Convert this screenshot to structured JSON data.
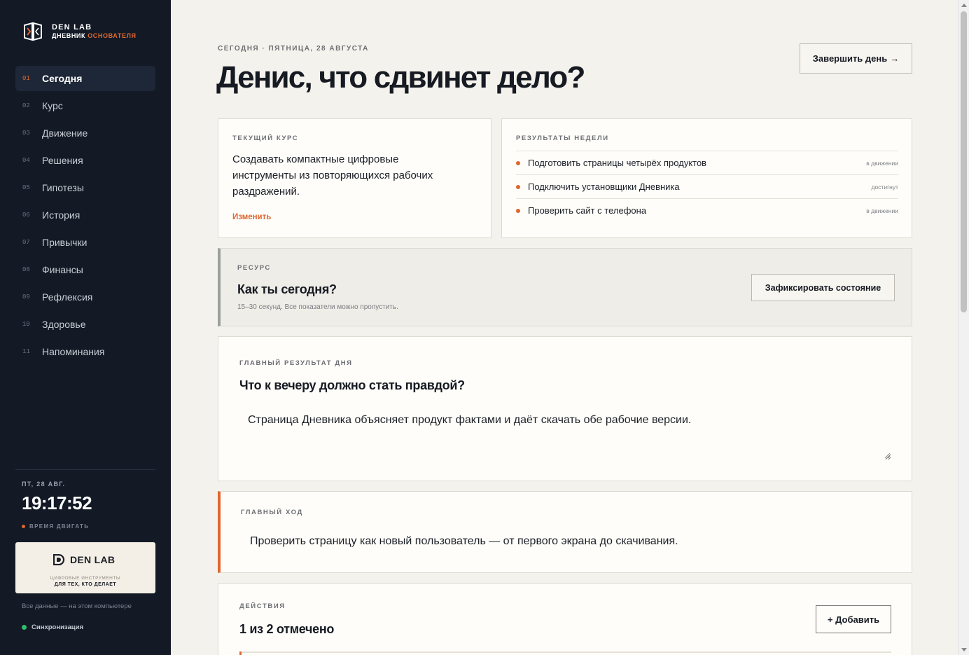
{
  "brand": {
    "name": "DEN LAB",
    "sub_prefix": "ДНЕВНИК",
    "sub_accent": "ОСНОВАТЕЛЯ"
  },
  "nav": [
    {
      "num": "01",
      "label": "Сегодня"
    },
    {
      "num": "02",
      "label": "Курс"
    },
    {
      "num": "03",
      "label": "Движение"
    },
    {
      "num": "04",
      "label": "Решения"
    },
    {
      "num": "05",
      "label": "Гипотезы"
    },
    {
      "num": "06",
      "label": "История"
    },
    {
      "num": "07",
      "label": "Привычки"
    },
    {
      "num": "08",
      "label": "Финансы"
    },
    {
      "num": "09",
      "label": "Рефлексия"
    },
    {
      "num": "10",
      "label": "Здоровье"
    },
    {
      "num": "11",
      "label": "Напоминания"
    }
  ],
  "sidebar": {
    "date": "ПТ, 28 АВГ.",
    "clock": "19:17:52",
    "motto": "ВРЕМЯ ДВИГАТЬ",
    "promo": {
      "name": "DEN LAB",
      "line1": "ЦИФРОВЫЕ ИНСТРУМЕНТЫ",
      "line2": "ДЛЯ ТЕХ, КТО ДЕЛАЕТ"
    },
    "local_note": "Все данные — на этом компьютере",
    "sync_label": "Синхронизация"
  },
  "header": {
    "eyebrow": "СЕГОДНЯ · ПЯТНИЦА, 28 АВГУСТА",
    "title": "Денис, что сдвинет дело?",
    "finish_label": "Завершить день",
    "finish_arrow": "→"
  },
  "course": {
    "label": "ТЕКУЩИЙ КУРС",
    "text": "Создавать компактные цифровые инструменты из повторяющихся рабочих раздражений.",
    "edit_label": "Изменить"
  },
  "week_results": {
    "label": "РЕЗУЛЬТАТЫ НЕДЕЛИ",
    "items": [
      {
        "text": "Подготовить страницы четырёх продуктов",
        "status": "в движении"
      },
      {
        "text": "Подключить установщики Дневника",
        "status": "достигнут"
      },
      {
        "text": "Проверить сайт с телефона",
        "status": "в движении"
      }
    ]
  },
  "resource": {
    "label": "РЕСУРС",
    "title": "Как ты сегодня?",
    "hint": "15–30 секунд. Все показатели можно пропустить.",
    "button_label": "Зафиксировать состояние"
  },
  "main_result": {
    "label": "ГЛАВНЫЙ РЕЗУЛЬТАТ ДНЯ",
    "title": "Что к вечеру должно стать правдой?",
    "value": "Страница Дневника объясняет продукт фактами и даёт скачать обе рабочие версии."
  },
  "main_move": {
    "label": "ГЛАВНЫЙ ХОД",
    "text": "Проверить страницу как новый пользователь — от первого экрана до скачивания."
  },
  "actions": {
    "label": "ДЕЙСТВИЯ",
    "summary": "1 из 2 отмечено",
    "add_label": "+ Добавить"
  },
  "colors": {
    "accent": "#e0662f",
    "sidebar_bg": "#131a26",
    "page_bg": "#f4f2ec",
    "sync_ok": "#2fbf6b"
  }
}
